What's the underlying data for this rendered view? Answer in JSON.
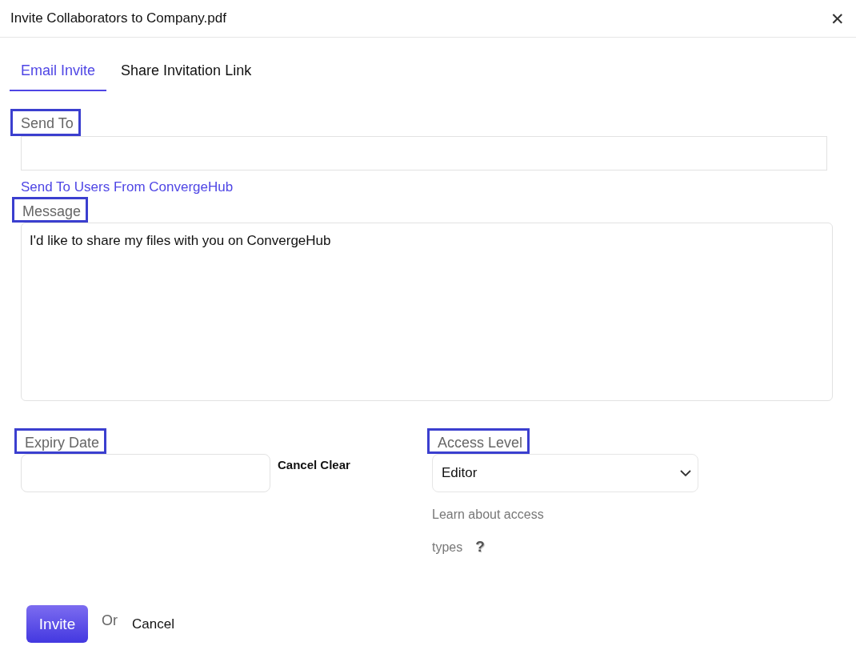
{
  "window": {
    "title": "Invite Collaborators to Company.pdf",
    "close": "✕"
  },
  "tabs": [
    {
      "label": "Email Invite",
      "selected": true
    },
    {
      "label": "Share Invitation Link",
      "selected": false
    }
  ],
  "send_to": {
    "label": "Send To",
    "link": "Send To Users From ConvergeHub"
  },
  "message": {
    "label": "Message",
    "value": "I'd like to share my files with you on ConvergeHub"
  },
  "expiry_date": {
    "label": "Expiry Date",
    "actions": "Cancel Clear"
  },
  "access_level": {
    "label": "Access Level",
    "value": "Editor",
    "help_text_lines": [
      "Learn about access",
      "types"
    ],
    "help_icon": "?"
  },
  "footer": {
    "invite": "Invite",
    "or": "Or",
    "cancel": "Cancel"
  }
}
